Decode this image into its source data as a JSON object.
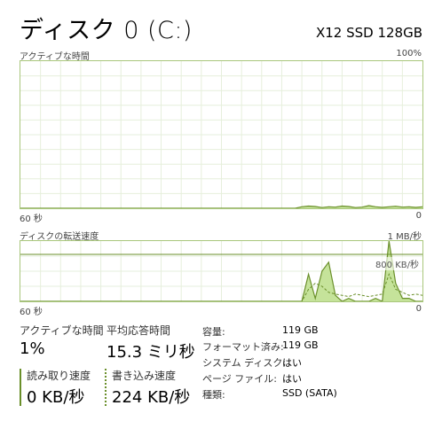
{
  "header": {
    "title": "ディスク 0 (C:)",
    "device": "X12 SSD 128GB"
  },
  "chart_active": {
    "label": "アクティブな時間",
    "max_label": "100%",
    "x_left": "60 秒",
    "x_right": "0"
  },
  "chart_transfer": {
    "label": "ディスクの転送速度",
    "max_label": "1 MB/秒",
    "ref_label": "800 KB/秒",
    "x_left": "60 秒",
    "x_right": "0"
  },
  "stats": {
    "active_time_label": "アクティブな時間",
    "active_time_value": "1%",
    "avg_response_label": "平均応答時間",
    "avg_response_value": "15.3 ミリ秒",
    "read_speed_label": "読み取り速度",
    "read_speed_value": "0 KB/秒",
    "write_speed_label": "書き込み速度",
    "write_speed_value": "224 KB/秒"
  },
  "info": {
    "capacity_key": "容量:",
    "capacity_val": "119 GB",
    "formatted_key": "フォーマット済み:",
    "formatted_val": "119 GB",
    "system_disk_key": "システム ディスク:",
    "system_disk_val": "はい",
    "page_file_key": "ページ ファイル:",
    "page_file_val": "はい",
    "type_key": "種類:",
    "type_val": "SSD (SATA)"
  },
  "colors": {
    "accent": "#6a8f2a",
    "fill": "#c5e39a",
    "grid": "#e6efdc",
    "border": "#a9c77c"
  },
  "chart_data": [
    {
      "type": "area",
      "x": [
        0,
        1,
        2,
        3,
        4,
        5,
        6,
        7,
        8,
        9,
        10,
        11,
        12,
        13,
        14,
        15,
        16,
        17,
        18,
        19,
        20,
        21,
        22,
        23,
        24,
        25,
        26,
        27,
        28,
        29,
        30,
        31,
        32,
        33,
        34,
        35,
        36,
        37,
        38,
        39,
        40,
        41,
        42,
        43,
        44,
        45,
        46,
        47,
        48,
        49,
        50,
        51,
        52,
        53,
        54,
        55,
        56,
        57,
        58,
        59,
        60
      ],
      "values": [
        0,
        0,
        0,
        0,
        0,
        0,
        0,
        0,
        0,
        0,
        0,
        0,
        0,
        0,
        0,
        0,
        0,
        0,
        0,
        0,
        0,
        0,
        0,
        0,
        0,
        0,
        0,
        0,
        0,
        0,
        0,
        0,
        0,
        0,
        0,
        0,
        0,
        0,
        0,
        0,
        0,
        0,
        1,
        1.5,
        1.2,
        0.5,
        1,
        0.8,
        1.5,
        1.2,
        0.5,
        0.8,
        1.8,
        1,
        0.6,
        1,
        1.4,
        0.8,
        1,
        0.6,
        1
      ],
      "ylim": [
        0,
        100
      ],
      "grid": true
    },
    {
      "type": "area",
      "x": [
        0,
        1,
        2,
        3,
        4,
        5,
        6,
        7,
        8,
        9,
        10,
        11,
        12,
        13,
        14,
        15,
        16,
        17,
        18,
        19,
        20,
        21,
        22,
        23,
        24,
        25,
        26,
        27,
        28,
        29,
        30,
        31,
        32,
        33,
        34,
        35,
        36,
        37,
        38,
        39,
        40,
        41,
        42,
        43,
        44,
        45,
        46,
        47,
        48,
        49,
        50,
        51,
        52,
        53,
        54,
        55,
        56,
        57,
        58,
        59,
        60
      ],
      "series": [
        {
          "values": [
            0,
            0,
            0,
            0,
            0,
            0,
            0,
            0,
            0,
            0,
            0,
            0,
            0,
            0,
            0,
            0,
            0,
            0,
            0,
            0,
            0,
            0,
            0,
            0,
            0,
            0,
            0,
            0,
            0,
            0,
            0,
            0,
            0,
            0,
            0,
            0,
            0,
            0,
            0,
            0,
            0,
            0,
            0,
            0.45,
            0.05,
            0.5,
            0.65,
            0.1,
            0,
            0.05,
            0,
            0,
            0,
            0.05,
            0,
            1.0,
            0.3,
            0.05,
            0.05,
            0,
            0
          ]
        },
        {
          "values": [
            0,
            0,
            0,
            0,
            0,
            0,
            0,
            0,
            0,
            0,
            0,
            0,
            0,
            0,
            0,
            0,
            0,
            0,
            0,
            0,
            0,
            0,
            0,
            0,
            0,
            0,
            0,
            0,
            0,
            0,
            0,
            0,
            0,
            0,
            0,
            0,
            0,
            0,
            0,
            0,
            0,
            0,
            0,
            0.2,
            0.3,
            0.25,
            0.15,
            0.12,
            0.1,
            0.08,
            0.12,
            0.1,
            0.08,
            0.1,
            0.12,
            0.45,
            0.2,
            0.15,
            0.1,
            0.12,
            0.1
          ]
        }
      ],
      "ylim": [
        0,
        1
      ],
      "ref_line": 0.78,
      "grid": true
    }
  ]
}
